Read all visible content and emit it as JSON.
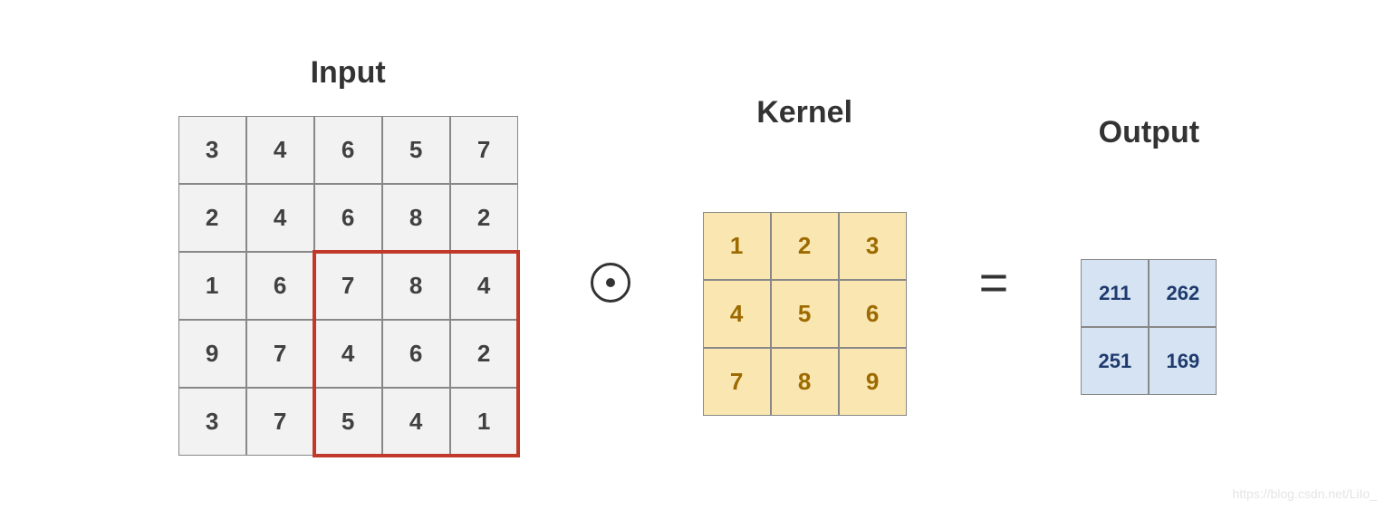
{
  "titles": {
    "input": "Input",
    "kernel": "Kernel",
    "output": "Output"
  },
  "operators": {
    "equals": "="
  },
  "input_matrix": [
    [
      3,
      4,
      6,
      5,
      7
    ],
    [
      2,
      4,
      6,
      8,
      2
    ],
    [
      1,
      6,
      7,
      8,
      4
    ],
    [
      9,
      7,
      4,
      6,
      2
    ],
    [
      3,
      7,
      5,
      4,
      1
    ]
  ],
  "kernel_matrix": [
    [
      1,
      2,
      3
    ],
    [
      4,
      5,
      6
    ],
    [
      7,
      8,
      9
    ]
  ],
  "output_matrix": [
    [
      211,
      262
    ],
    [
      251,
      169
    ]
  ],
  "highlight": {
    "row_start": 2,
    "col_start": 2,
    "rows": 3,
    "cols": 3
  },
  "watermark": "https://blog.csdn.net/LiIo_"
}
